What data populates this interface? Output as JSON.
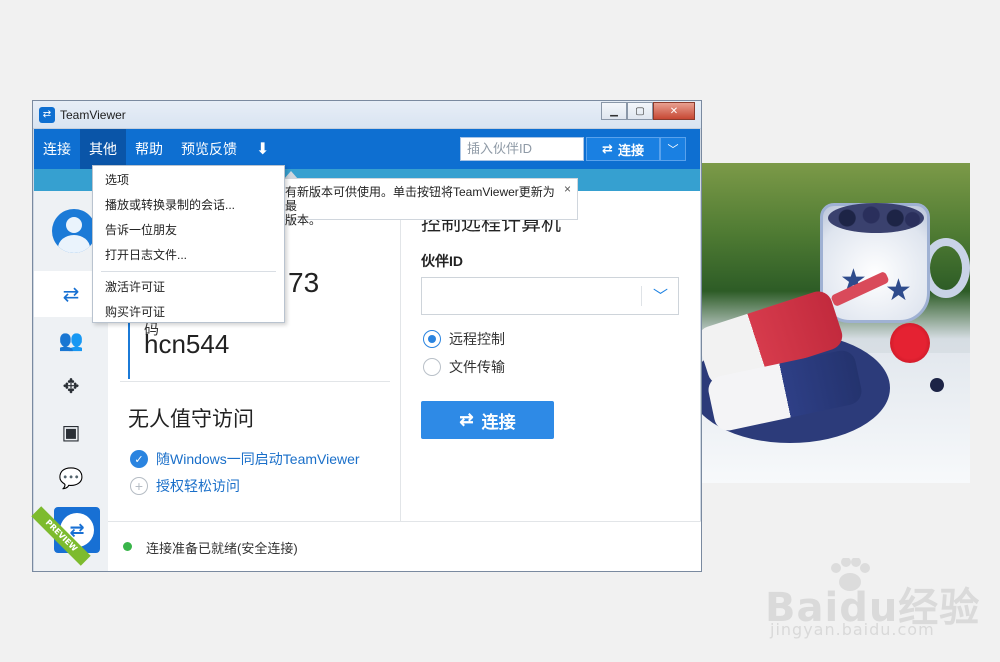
{
  "window": {
    "title": "TeamViewer"
  },
  "menubar": {
    "items": [
      "连接",
      "其他",
      "帮助",
      "预览反馈"
    ],
    "partner_id_placeholder": "插入伙伴ID",
    "connect_label": "连接"
  },
  "dropdown": {
    "group1": [
      "选项",
      "播放或转换录制的会话...",
      "告诉一位朋友",
      "打开日志文件..."
    ],
    "group2": [
      "激活许可证",
      "购买许可证"
    ]
  },
  "tooltip": {
    "line1": "有新版本可供使用。单击按钮将TeamViewer更新为最",
    "line2": "版本。",
    "close": "×"
  },
  "left_panel": {
    "id_partial": "73",
    "password_label": "密码",
    "password": "hcn544",
    "unattended_title": "无人值守访问",
    "option_start_with_windows": "随Windows一同启动TeamViewer",
    "option_easy_access": "授权轻松访问"
  },
  "right_panel": {
    "title": "控制远程计算机",
    "partner_id_label": "伙伴ID",
    "partner_id_value": "",
    "radio_remote_control": "远程控制",
    "radio_file_transfer": "文件传输",
    "connect_button": "连接"
  },
  "sidebar": {
    "preview_badge": "PREVIEW"
  },
  "status": {
    "text": "连接准备已就绪(安全连接)",
    "color": "#39b54a"
  },
  "watermark": {
    "brand": "Baidu经验",
    "url": "jingyan.baidu.com"
  },
  "colors": {
    "accent": "#0e6fd1",
    "notice": "#36a0d0"
  }
}
